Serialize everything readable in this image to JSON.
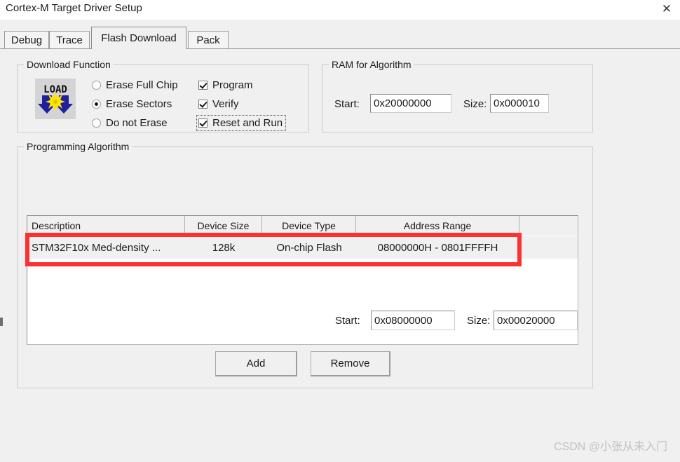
{
  "window": {
    "title": "Cortex-M Target Driver Setup",
    "close_icon": "close-icon",
    "close_glyph": "✕"
  },
  "tabs": [
    {
      "label": "Debug",
      "active": false
    },
    {
      "label": "Trace",
      "active": false
    },
    {
      "label": "Flash Download",
      "active": true
    },
    {
      "label": "Pack",
      "active": false
    }
  ],
  "download_function": {
    "legend": "Download Function",
    "icon_name": "load-icon",
    "icon_text": "LOAD",
    "erase_options": [
      {
        "label": "Erase Full Chip",
        "selected": false
      },
      {
        "label": "Erase Sectors",
        "selected": true
      },
      {
        "label": "Do not Erase",
        "selected": false
      }
    ],
    "checkboxes": [
      {
        "label": "Program",
        "checked": true,
        "focused": false
      },
      {
        "label": "Verify",
        "checked": true,
        "focused": false
      },
      {
        "label": "Reset and Run",
        "checked": true,
        "focused": true
      }
    ]
  },
  "ram_for_algorithm": {
    "legend": "RAM for Algorithm",
    "start_label": "Start:",
    "start_value": "0x20000000",
    "size_label": "Size:",
    "size_value": "0x000010"
  },
  "programming_algorithm": {
    "legend": "Programming Algorithm",
    "columns": [
      "Description",
      "Device Size",
      "Device Type",
      "Address Range",
      ""
    ],
    "rows": [
      {
        "description": "STM32F10x Med-density ...",
        "device_size": "128k",
        "device_type": "On-chip Flash",
        "address_range": "08000000H - 0801FFFFH",
        "extra": "",
        "highlighted": true
      }
    ],
    "start_label": "Start:",
    "start_value": "0x08000000",
    "size_label": "Size:",
    "size_value": "0x00020000"
  },
  "buttons": {
    "add": "Add",
    "remove": "Remove"
  },
  "annotation": {
    "color": "#fa3232",
    "target": "selected-algorithm-row"
  },
  "watermark": "CSDN @小张从未入门"
}
